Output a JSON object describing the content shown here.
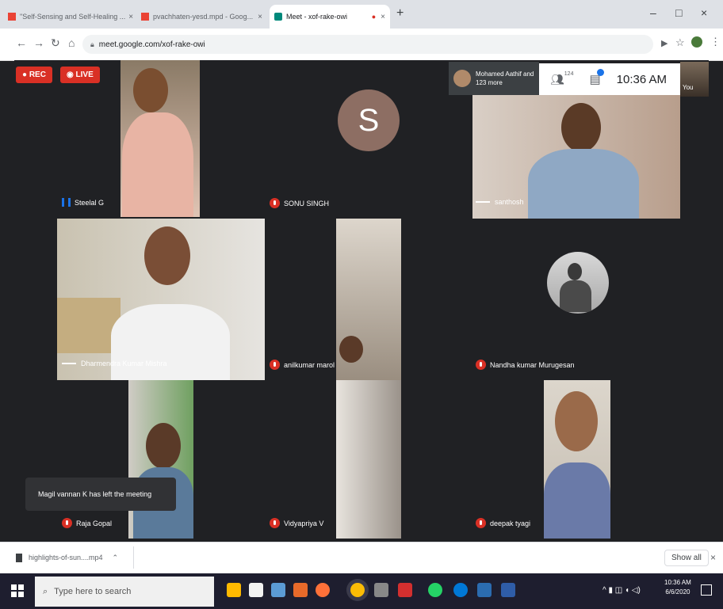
{
  "browser": {
    "tabs": [
      {
        "title": "\"Self-Sensing and Self-Healing ...",
        "active": false
      },
      {
        "title": "pvachhaten-yesd.mpd - Goog...",
        "active": false
      },
      {
        "title": "Meet - xof-rake-owi",
        "active": true
      }
    ],
    "new_tab": "+",
    "window_controls": {
      "minimize": "–",
      "maximize": "□",
      "close": "×"
    },
    "url": "meet.google.com/xof-rake-owi"
  },
  "meet": {
    "rec_label": "REC",
    "live_label": "LIVE",
    "presenter_summary": "Mohamed Aathif and 123 more",
    "people_count": "124",
    "time": "10:36 AM",
    "you_label": "You",
    "avatar_letter": "S",
    "participants": [
      {
        "name": "Steelal G",
        "muted": false
      },
      {
        "name": "SONU SINGH",
        "muted": true
      },
      {
        "name": "santhosh",
        "muted": false
      },
      {
        "name": "Dharmendra Kumar Mishra",
        "muted": false
      },
      {
        "name": "anilkumar marol",
        "muted": true
      },
      {
        "name": "Nandha kumar Murugesan",
        "muted": true
      },
      {
        "name": "Raja Gopal",
        "muted": true
      },
      {
        "name": "Vidyapriya V",
        "muted": true
      },
      {
        "name": "deepak tyagi",
        "muted": true
      }
    ],
    "toast": "Magil vannan K has left the meeting"
  },
  "downloads": {
    "item": "highlights-of-sun....mp4",
    "show_all": "Show all",
    "close": "×"
  },
  "taskbar": {
    "search_placeholder": "Type here to search",
    "clock_time": "10:36 AM",
    "clock_date": "6/6/2020"
  },
  "colors": {
    "mic_off": "#d93025",
    "meet_bg": "#202124",
    "rec": "#d93025"
  }
}
